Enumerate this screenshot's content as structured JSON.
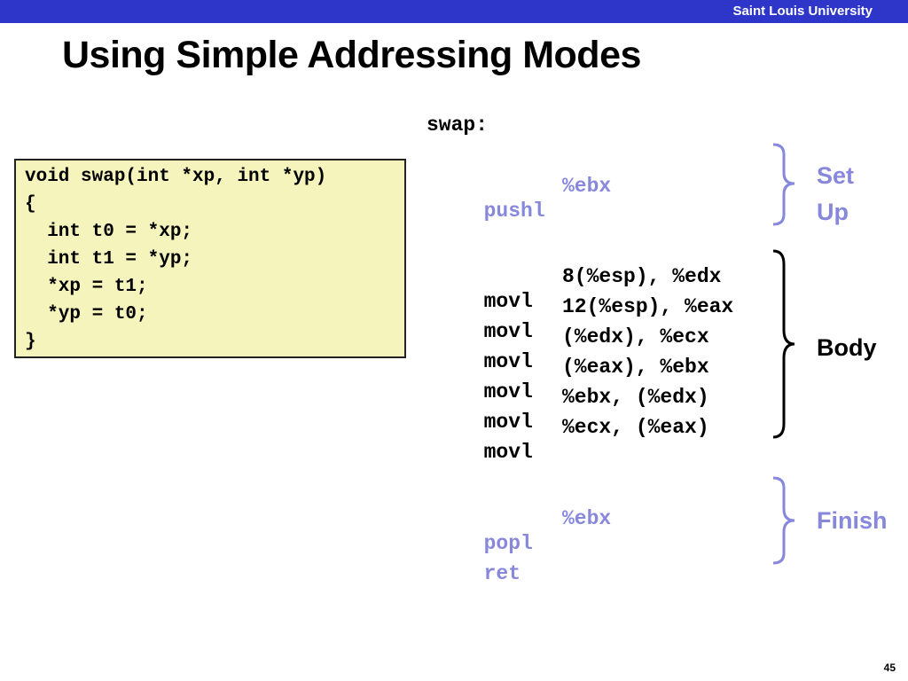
{
  "header": {
    "institution": "Saint Louis University"
  },
  "slide": {
    "title": "Using Simple Addressing Modes",
    "page_number": "45",
    "colors": {
      "banner": "#2e35c9",
      "code_box": "#f6f4bd",
      "highlight": "#8787dc"
    }
  },
  "c_code": {
    "lines": [
      "void swap(int *xp, int *yp)",
      "{",
      "  int t0 = *xp;",
      "  int t1 = *yp;",
      "  *xp = t1;",
      "  *yp = t0;",
      "}"
    ]
  },
  "assembly": {
    "label": "swap:",
    "setup": [
      {
        "op": "pushl",
        "arg": "%ebx"
      }
    ],
    "body": [
      {
        "op": "movl",
        "arg": "8(%esp), %edx"
      },
      {
        "op": "movl",
        "arg": "12(%esp), %eax"
      },
      {
        "op": "movl",
        "arg": "(%edx), %ecx"
      },
      {
        "op": "movl",
        "arg": "(%eax), %ebx"
      },
      {
        "op": "movl",
        "arg": "%ebx, (%edx)"
      },
      {
        "op": "movl",
        "arg": "%ecx, (%eax)"
      }
    ],
    "finish": [
      {
        "op": "popl",
        "arg": "%ebx"
      },
      {
        "op": "ret",
        "arg": ""
      }
    ]
  },
  "annotations": {
    "setup_line1": "Set",
    "setup_line2": "Up",
    "body": "Body",
    "finish": "Finish"
  }
}
